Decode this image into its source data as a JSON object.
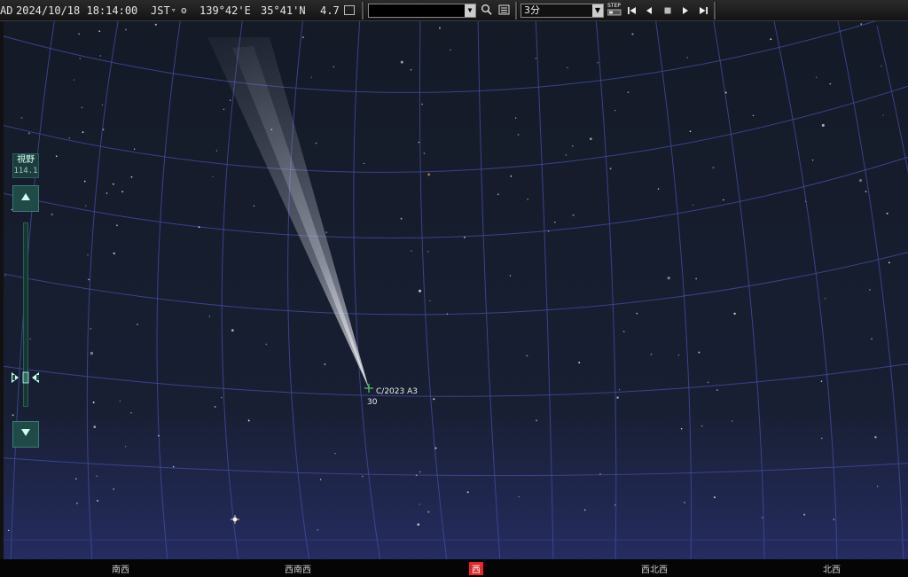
{
  "toolbar": {
    "era": "AD",
    "datetime": "2024/10/18 18:14:00",
    "timezone": "JST",
    "timezone_marker": "▿",
    "now_button_glyph": "ʘ",
    "longitude": "139°42'E",
    "latitude": "35°41'N",
    "magnitude": "4.7",
    "search_placeholder": "",
    "search_icon": "search-icon",
    "list_icon": "list-icon",
    "step_value": "3分",
    "step_label": "STEP",
    "playback": [
      "skip-back-icon",
      "step-back-icon",
      "stop-icon",
      "step-forward-icon",
      "skip-forward-icon"
    ]
  },
  "fov": {
    "name": "視野",
    "value": "114.1"
  },
  "sky": {
    "object_name": "C/2023 A3",
    "object_altitude": "30"
  },
  "directions": [
    {
      "label": "南西",
      "active": false
    },
    {
      "label": "西南西",
      "active": false
    },
    {
      "label": "西",
      "active": true
    },
    {
      "label": "西北西",
      "active": false
    },
    {
      "label": "北西",
      "active": false
    }
  ],
  "colors": {
    "sky_top": "#141a26",
    "sky_bottom": "#232a5a",
    "grid": "#3f4a9a",
    "active_direction": "#e02828",
    "fov_panel": "#1f4a48"
  }
}
